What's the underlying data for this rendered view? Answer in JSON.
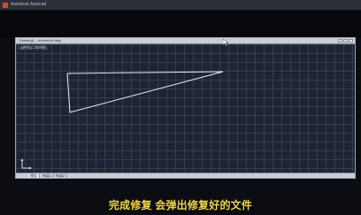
{
  "app": {
    "title": "Autodesk Autocad",
    "window_title": "Drawing1 - recovered.dwg",
    "viewport_label": "[-][俯视][二维线框]"
  },
  "tabs": [
    {
      "label": "模型"
    },
    {
      "label": "布局1"
    },
    {
      "label": "布局2"
    }
  ],
  "caption": {
    "text": "完成修复 会弹出修复好的文件"
  },
  "colors": {
    "caption": "#f1d54a",
    "viewport_bg": "#1d2433",
    "line": "#e8eef6"
  }
}
